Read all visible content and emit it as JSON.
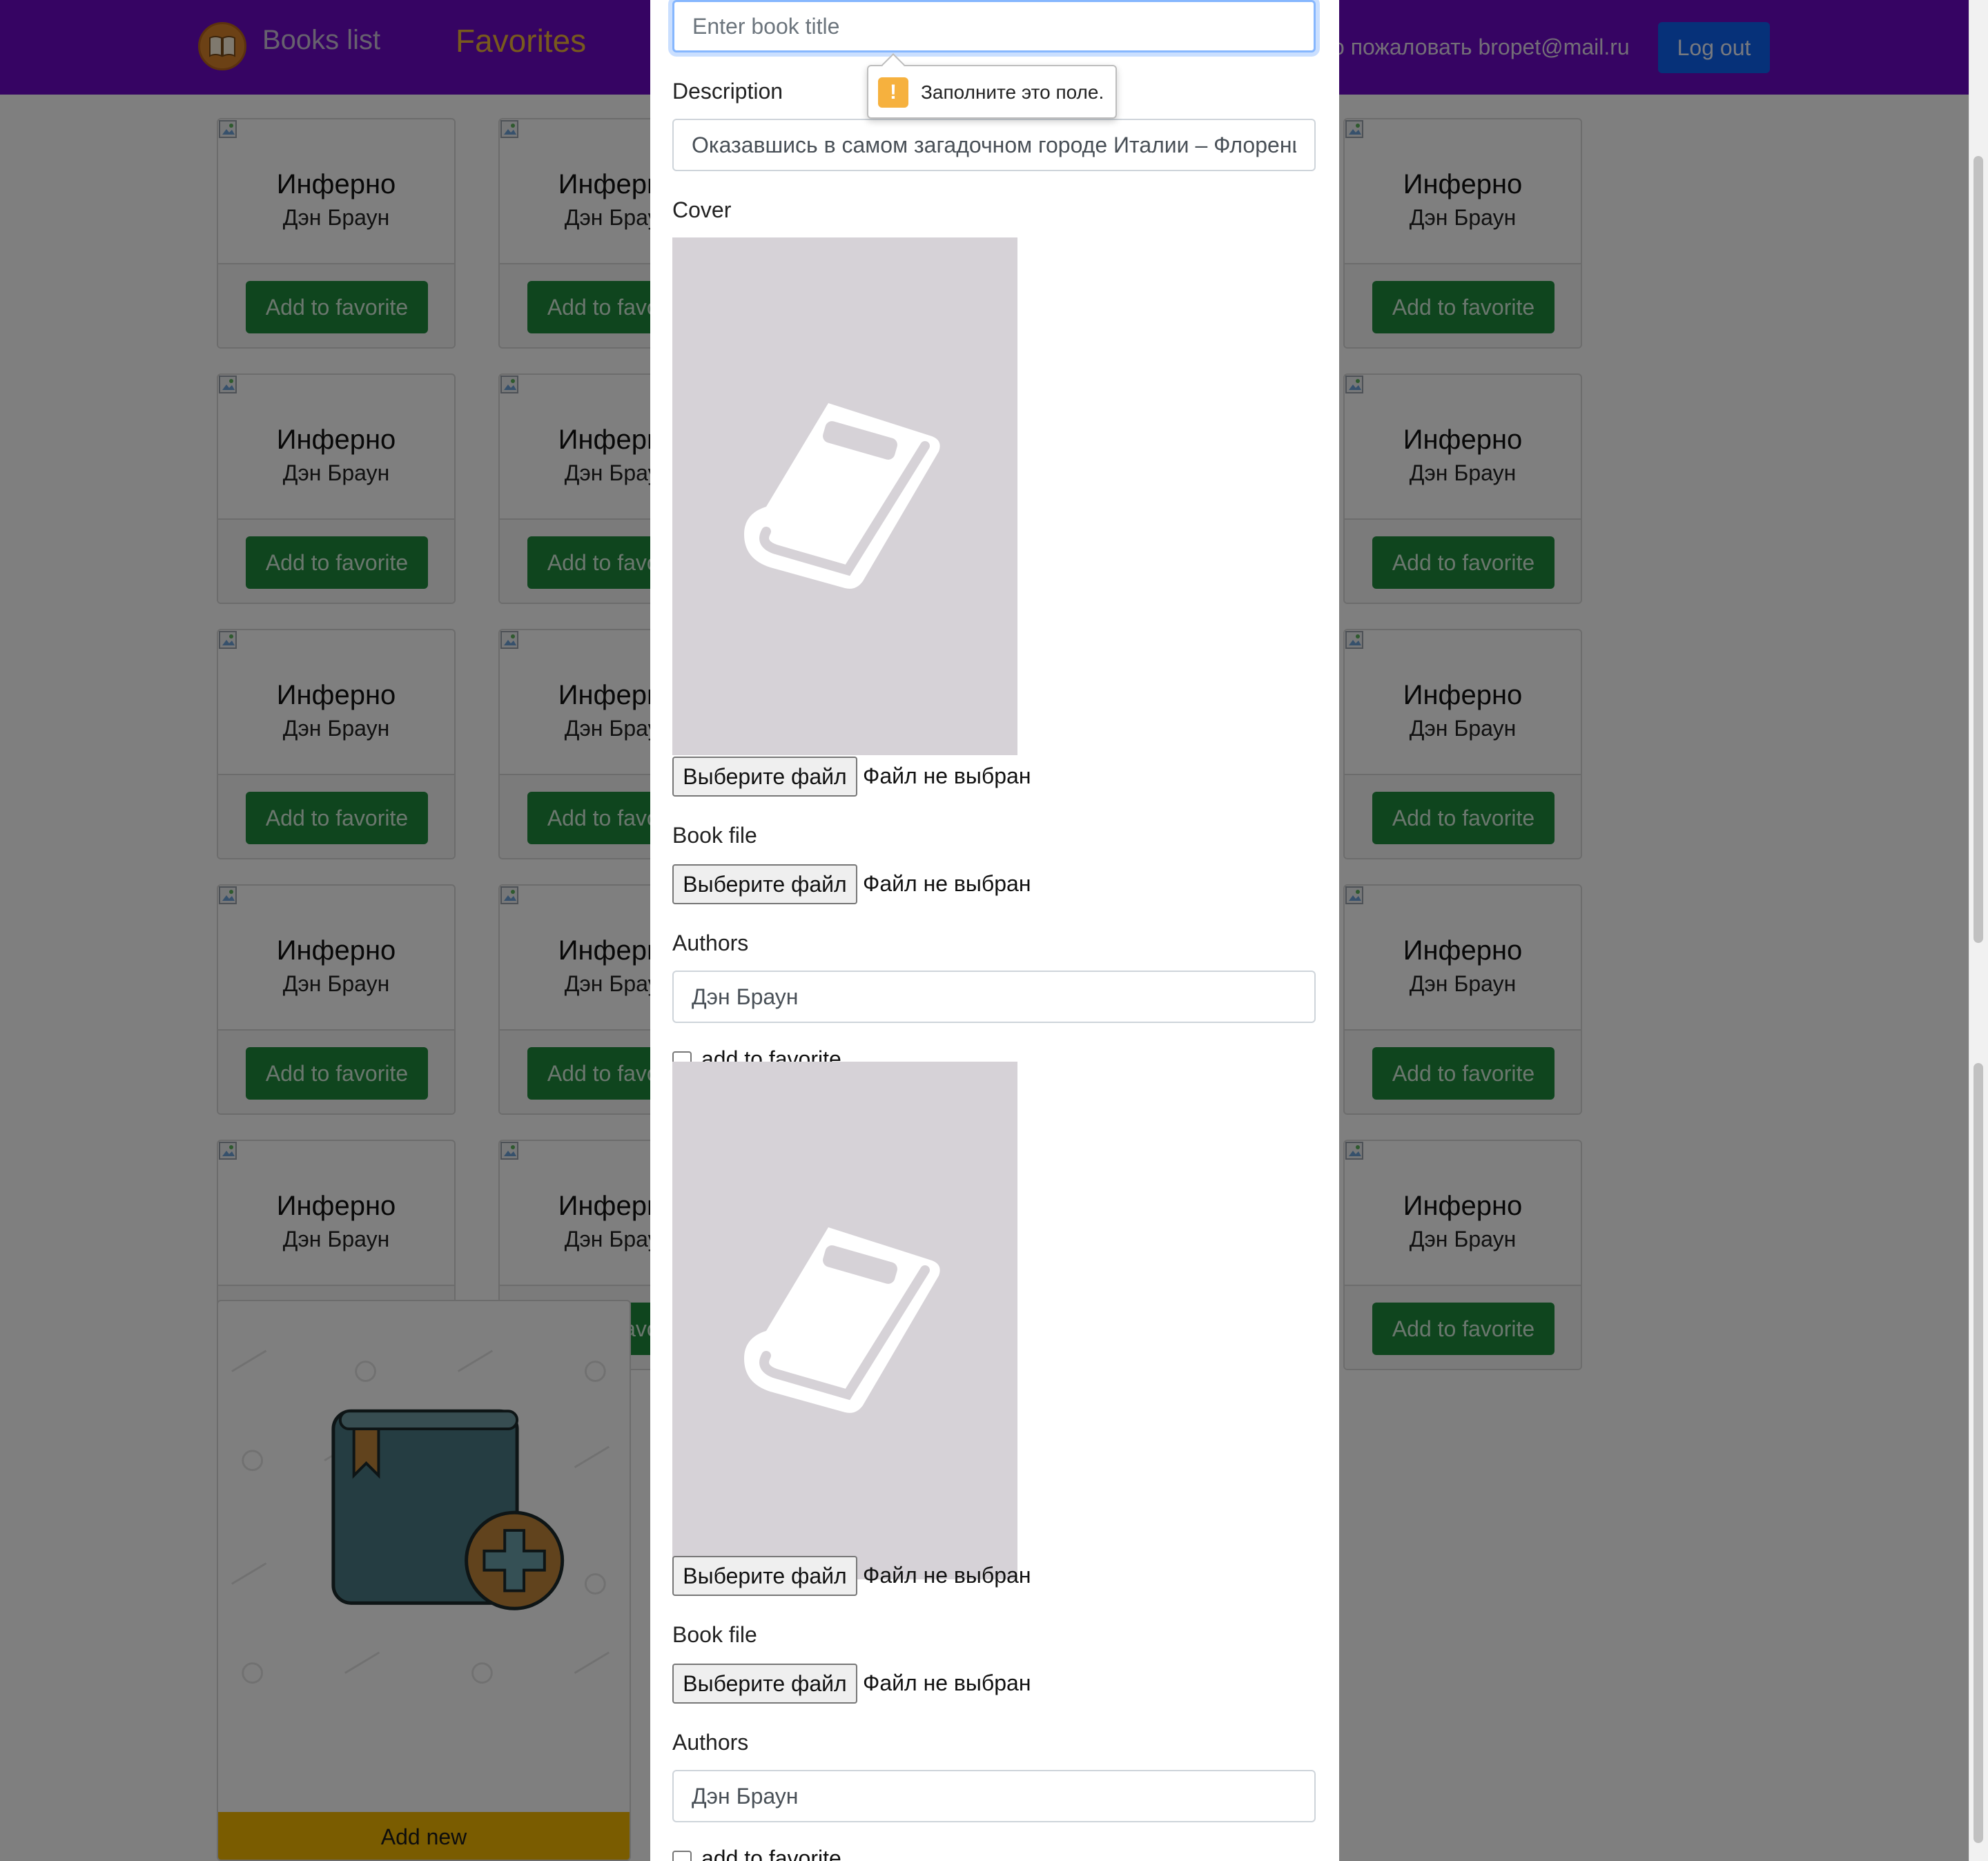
{
  "navbar": {
    "brand_label": "Books list",
    "favorites_label": "Favorites",
    "welcome_text": "о пожаловать bropet@mail.ru",
    "logout_label": "Log out"
  },
  "books": [
    {
      "title": "Инферно",
      "author": "Дэн Браун",
      "button": "Add to favorite"
    },
    {
      "title": "Инферно",
      "author": "Дэн Браун",
      "button": "Add to favorite"
    },
    {
      "title": "Инферно",
      "author": "Дэн Браун",
      "button": "Add to favorite"
    },
    {
      "title": "Инферно",
      "author": "Дэн Браун",
      "button": "Add to favorite"
    },
    {
      "title": "Инферно",
      "author": "Дэн Браун",
      "button": "Add to favorite"
    },
    {
      "title": "Инферно",
      "author": "Дэн Браун",
      "button": "Add to favorite"
    },
    {
      "title": "Инферно",
      "author": "Дэн Браун",
      "button": "Add to favorite"
    },
    {
      "title": "Инферно",
      "author": "Дэн Браун",
      "button": "Add to favorite"
    },
    {
      "title": "Инферно",
      "author": "Дэн Браун",
      "button": "Add to favorite"
    },
    {
      "title": "Инферно",
      "author": "Дэн Браун",
      "button": "Add to favorite"
    },
    {
      "title": "Инферно",
      "author": "Дэн Браун",
      "button": "Add to favorite"
    },
    {
      "title": "Инферно",
      "author": "Дэн Браун",
      "button": "Add to favorite"
    },
    {
      "title": "Инферно",
      "author": "Дэн Браун",
      "button": "Add to favorite"
    },
    {
      "title": "Инферно",
      "author": "Дэн Браун",
      "button": "Add to favorite"
    },
    {
      "title": "Инферно",
      "author": "Дэн Браун",
      "button": "Add to favorite"
    }
  ],
  "add_card": {
    "button_label": "Add new"
  },
  "modal": {
    "title_placeholder": "Enter book title",
    "tooltip_text": "Заполните это поле.",
    "description_label": "Description",
    "description_value": "Оказавшись в самом загадочном городе Италии – Флоренции",
    "cover_label": "Cover",
    "file_button": "Выберите файл",
    "file_status": "Файл не выбран",
    "book_file_label": "Book file",
    "authors_label": "Authors",
    "authors_value": "Дэн Браун",
    "checkbox_label": "add to favorite"
  },
  "colors": {
    "navbar": "#6d08c6",
    "favorite_button": "#1f8a3c",
    "logout_button": "#0d63f3",
    "add_new_button": "#f5b800",
    "favorites_link": "#f0b43a"
  },
  "icons": [
    "book-logo-icon",
    "broken-image-icon",
    "book-placeholder-icon",
    "add-book-icon",
    "warning-icon"
  ]
}
